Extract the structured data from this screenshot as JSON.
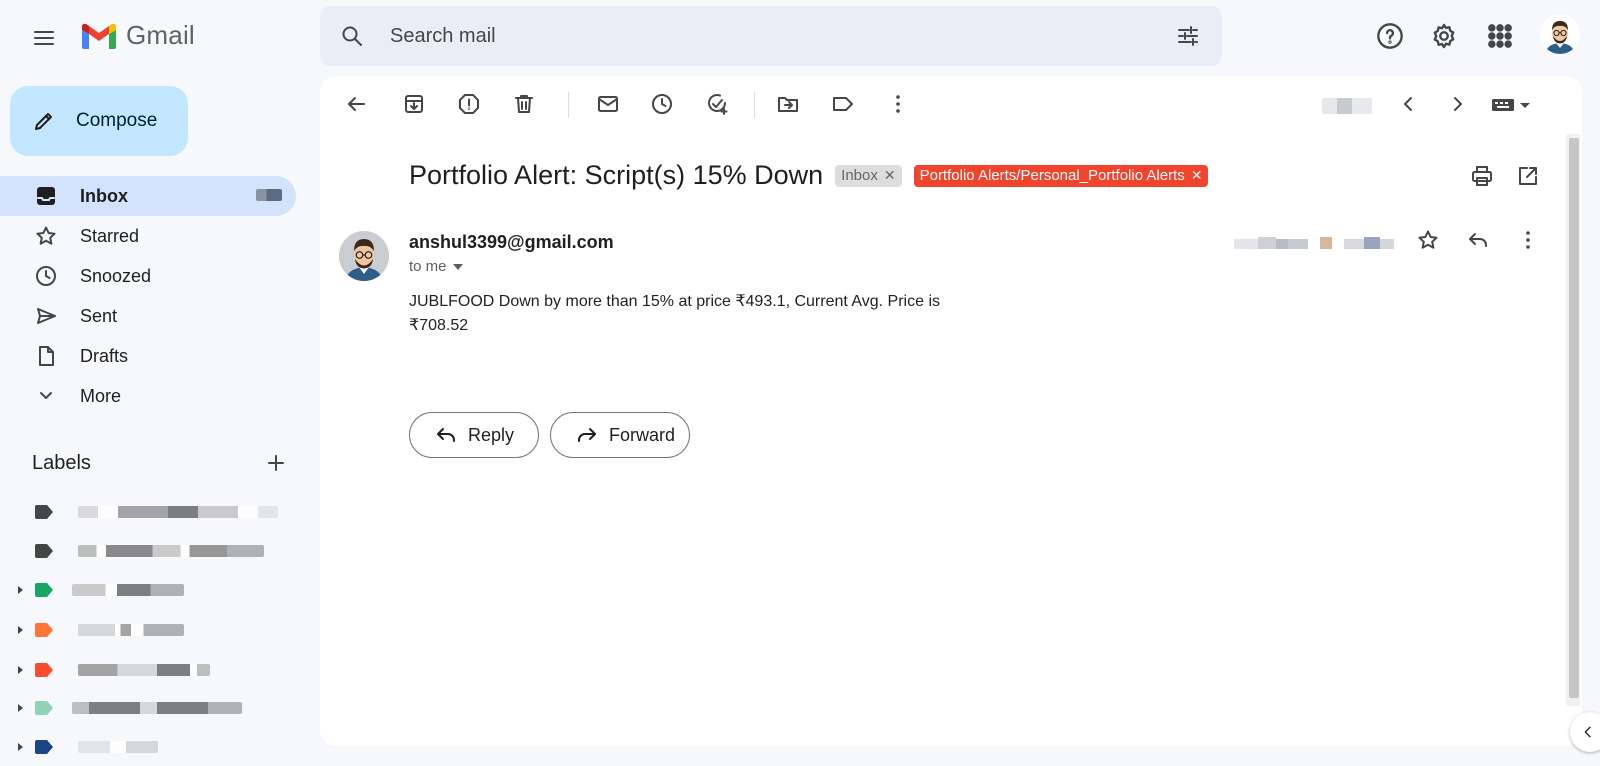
{
  "app": {
    "name": "Gmail",
    "brand_colors": {
      "red": "#EA4335",
      "blue": "#4285F4",
      "green": "#34A853",
      "yellow": "#FBBC04"
    }
  },
  "search": {
    "placeholder": "Search mail"
  },
  "compose": {
    "label": "Compose"
  },
  "nav": {
    "items": [
      {
        "label": "Inbox",
        "icon": "inbox-icon",
        "active": true
      },
      {
        "label": "Starred",
        "icon": "star-icon"
      },
      {
        "label": "Snoozed",
        "icon": "clock-icon"
      },
      {
        "label": "Sent",
        "icon": "send-icon"
      },
      {
        "label": "Drafts",
        "icon": "draft-icon"
      },
      {
        "label": "More",
        "icon": "chevron-down-icon"
      }
    ]
  },
  "labels": {
    "heading": "Labels",
    "tag_colors": [
      "#444746",
      "#444746",
      "#16a765",
      "#ff7537",
      "#fb4c2f",
      "#b3efd3",
      "#1c4587"
    ]
  },
  "message": {
    "subject": "Portfolio Alert: Script(s) 15% Down",
    "chips": [
      {
        "label": "Inbox",
        "style": "inbox"
      },
      {
        "label": "Portfolio Alerts/Personal_Portfolio Alerts",
        "style": "alert"
      }
    ],
    "sender": "anshul3399@gmail.com",
    "recipient": "to me",
    "body_line1": "JUBLFOOD Down by more than 15% at price ₹493.1, Current Avg. Price is",
    "body_line2": "₹708.52"
  },
  "actions": {
    "reply": "Reply",
    "forward": "Forward"
  }
}
